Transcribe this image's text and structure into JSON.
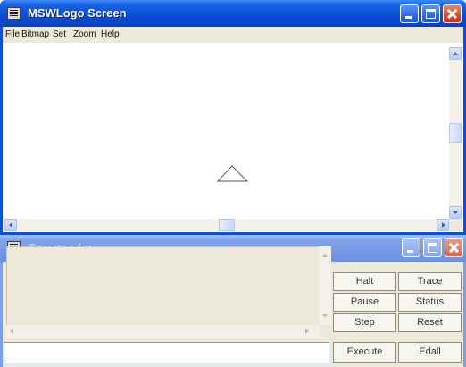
{
  "main_window": {
    "title": "MSWLogo Screen",
    "menu": [
      "File",
      "Bitmap",
      "Set",
      "Zoom",
      "Help"
    ]
  },
  "commander": {
    "title": "Commander",
    "buttons": {
      "halt": "Halt",
      "trace": "Trace",
      "pause": "Pause",
      "status": "Status",
      "step": "Step",
      "reset": "Reset",
      "execute": "Execute",
      "edall": "Edall"
    },
    "input_value": ""
  },
  "icons": [
    "app-icon",
    "minimize-icon",
    "maximize-icon",
    "close-icon",
    "turtle-icon",
    "arrow-up-icon",
    "arrow-down-icon",
    "arrow-left-icon",
    "arrow-right-icon"
  ],
  "colors": {
    "titlebar_active": "#0a4fd8",
    "titlebar_inactive": "#7599e6",
    "close_button": "#d8472a",
    "face": "#ece9d8"
  }
}
